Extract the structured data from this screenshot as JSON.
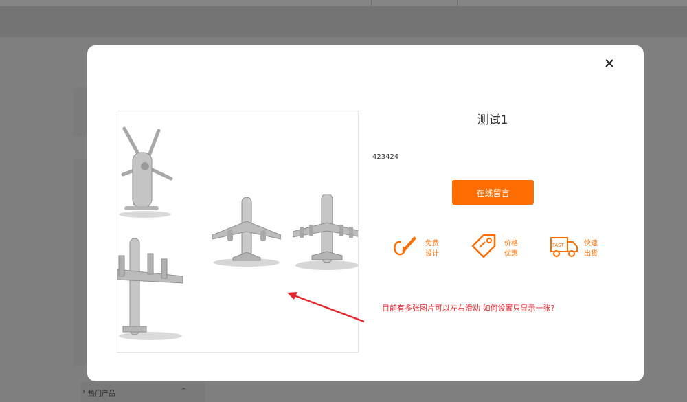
{
  "background": {
    "sidebar_hot_label": "热门产品"
  },
  "modal": {
    "title": "测试1",
    "description": "423424",
    "message_button": "在线留言",
    "features": [
      {
        "icon": "pen-hook-icon",
        "line1": "免费",
        "line2": "设计"
      },
      {
        "icon": "price-tag-icon",
        "line1": "价格",
        "line2": "优惠"
      },
      {
        "icon": "fast-truck-icon",
        "line1": "快速",
        "line2": "出货",
        "icon_text": "FAST"
      }
    ],
    "annotation": "目前有多张图片可以左右滑动  如何设置只显示一张?"
  },
  "colors": {
    "accent": "#ff6d00",
    "annotation": "#e3272f",
    "overlay": "#7f7f7f"
  }
}
